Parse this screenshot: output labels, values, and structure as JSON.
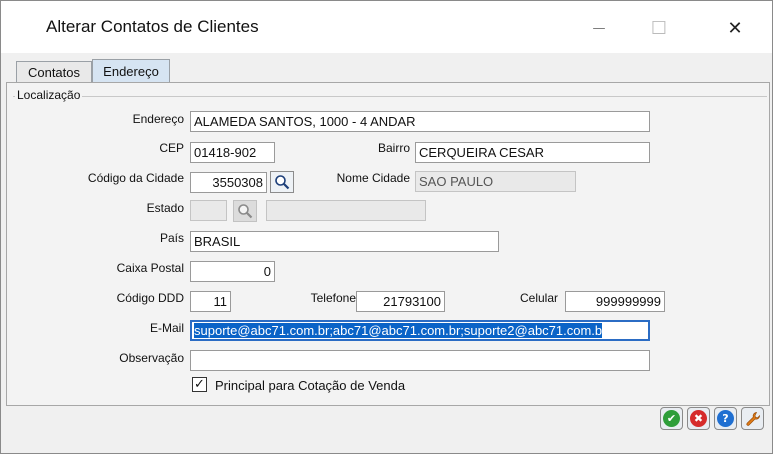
{
  "window": {
    "title": "Alterar Contatos de Clientes",
    "minimize_glyph": "—",
    "maximize_glyph": "☐",
    "close_glyph": "✕"
  },
  "tabs": [
    {
      "label": "Contatos",
      "active": false
    },
    {
      "label": "Endereço",
      "active": true
    }
  ],
  "group": {
    "legend": "Localização"
  },
  "form": {
    "endereco": {
      "label": "Endereço",
      "value": "ALAMEDA SANTOS, 1000 - 4 ANDAR"
    },
    "cep": {
      "label": "CEP",
      "value": "01418-902"
    },
    "bairro": {
      "label": "Bairro",
      "value": "CERQUEIRA CESAR"
    },
    "codigo_cidade": {
      "label": "Código da Cidade",
      "value": "3550308"
    },
    "nome_cidade": {
      "label": "Nome Cidade",
      "value": "SAO PAULO"
    },
    "estado": {
      "label": "Estado",
      "value": "",
      "name_value": ""
    },
    "pais": {
      "label": "País",
      "value": "BRASIL"
    },
    "caixa_postal": {
      "label": "Caixa Postal",
      "value": "0"
    },
    "codigo_ddd": {
      "label": "Código DDD",
      "value": "11"
    },
    "telefone": {
      "label": "Telefone",
      "value": "21793100"
    },
    "celular": {
      "label": "Celular",
      "value": "999999999"
    },
    "email": {
      "label": "E-Mail",
      "value": "suporte@abc71.com.br;abc71@abc71.com.br;suporte2@abc71.com.b"
    },
    "observacao": {
      "label": "Observação",
      "value": ""
    },
    "principal": {
      "label": "Principal para Cotação de Venda",
      "checked": true,
      "check_glyph": "✓"
    }
  },
  "actions": [
    {
      "name": "confirm",
      "icon": "check-icon",
      "color": "#2e9e3a",
      "glyph": "✔"
    },
    {
      "name": "cancel",
      "icon": "cancel-icon",
      "color": "#d62b2b",
      "glyph": "✖"
    },
    {
      "name": "help",
      "icon": "help-icon",
      "color": "#1f6fd1",
      "glyph": "?"
    },
    {
      "name": "tools",
      "icon": "wrench-icon",
      "color": "#e07b18",
      "glyph": "🔧"
    }
  ],
  "colors": {
    "selection": "#0a63c7",
    "active_tab": "#d6e4f2"
  }
}
